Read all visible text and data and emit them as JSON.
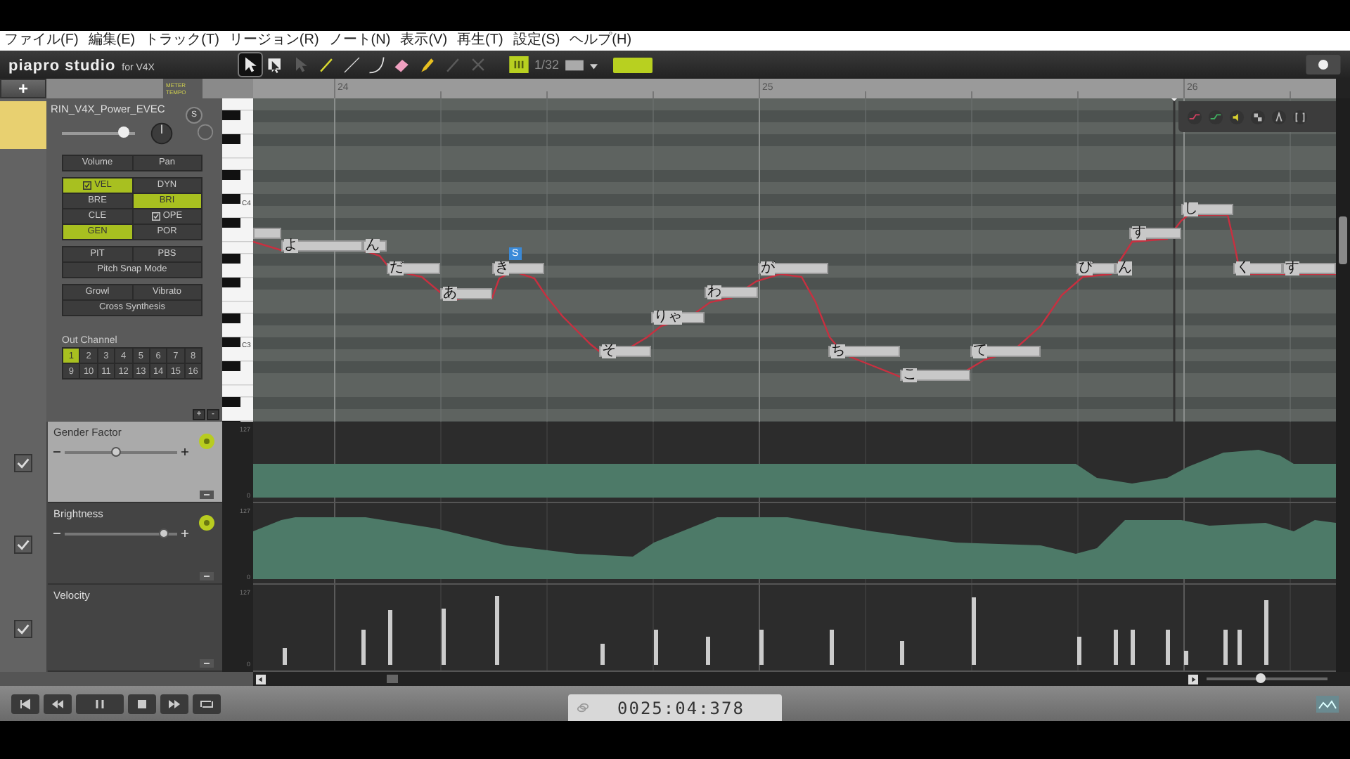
{
  "menu": [
    "ファイル(F)",
    "編集(E)",
    "トラック(T)",
    "リージョン(R)",
    "ノート(N)",
    "表示(V)",
    "再生(T)",
    "設定(S)",
    "ヘルプ(H)"
  ],
  "toolbar": {
    "logo": "piapro studio",
    "logo_sub": "for V4X",
    "quantize": "1/32",
    "tools": [
      {
        "kind": "pointer",
        "selected": true,
        "disabled": false
      },
      {
        "kind": "select",
        "selected": false,
        "disabled": false
      },
      {
        "kind": "pointer",
        "selected": false,
        "disabled": true
      },
      {
        "kind": "pencil",
        "selected": false,
        "disabled": false
      },
      {
        "kind": "line",
        "selected": false,
        "disabled": false
      },
      {
        "kind": "curve",
        "selected": false,
        "disabled": false
      },
      {
        "kind": "eraser",
        "selected": false,
        "disabled": false
      },
      {
        "kind": "brush",
        "selected": false,
        "disabled": false
      },
      {
        "kind": "pencil",
        "selected": false,
        "disabled": true
      },
      {
        "kind": "cross",
        "selected": false,
        "disabled": true
      }
    ]
  },
  "track": {
    "add": "+",
    "meter_tempo": [
      "METER",
      "TEMPO"
    ],
    "name": "RIN_V4X_Power_EVEC",
    "solo": "S",
    "volume": {
      "level": 0.85
    },
    "mix_buttons": [
      "Volume",
      "Pan"
    ],
    "params": [
      {
        "label": "VEL",
        "checked": true,
        "selected": true
      },
      {
        "label": "DYN",
        "checked": false,
        "selected": false
      },
      {
        "label": "BRE",
        "checked": false,
        "selected": false
      },
      {
        "label": "BRI",
        "checked": false,
        "selected": true
      },
      {
        "label": "CLE",
        "checked": false,
        "selected": false
      },
      {
        "label": "OPE",
        "checked": true,
        "selected": false
      },
      {
        "label": "GEN",
        "checked": false,
        "selected": true
      },
      {
        "label": "POR",
        "checked": false,
        "selected": false
      }
    ],
    "pitch_buttons": [
      "PIT",
      "PBS"
    ],
    "pitch_snap": "Pitch Snap Mode",
    "effects": [
      "Growl",
      "Vibrato"
    ],
    "cross": "Cross Synthesis",
    "out_channel": {
      "label": "Out Channel",
      "channels": [
        {
          "label": "1",
          "selected": true
        },
        {
          "label": "2",
          "selected": false
        },
        {
          "label": "3",
          "selected": false
        },
        {
          "label": "4",
          "selected": false
        },
        {
          "label": "5",
          "selected": false
        },
        {
          "label": "6",
          "selected": false
        },
        {
          "label": "7",
          "selected": false
        },
        {
          "label": "8",
          "selected": false
        },
        {
          "label": "9",
          "selected": false
        },
        {
          "label": "10",
          "selected": false
        },
        {
          "label": "11",
          "selected": false
        },
        {
          "label": "12",
          "selected": false
        },
        {
          "label": "13",
          "selected": false
        },
        {
          "label": "14",
          "selected": false
        },
        {
          "label": "15",
          "selected": false
        },
        {
          "label": "16",
          "selected": false
        }
      ]
    },
    "lane_buttons": [
      "+",
      "-"
    ]
  },
  "ruler": [
    "24",
    "25",
    "26"
  ],
  "keys": [
    "C4",
    "C3"
  ],
  "notes": [
    {
      "selected": false
    },
    {
      "lyric": "よ",
      "selected": false
    },
    {
      "lyric": "ん",
      "selected": false
    },
    {
      "lyric": "だ",
      "selected": false
    },
    {
      "lyric": "あ",
      "selected": false
    },
    {
      "lyric": "き",
      "selected": false,
      "badge": "S"
    },
    {
      "lyric": "そ",
      "selected": false
    },
    {
      "lyric": "りゃ",
      "selected": false
    },
    {
      "lyric": "わ",
      "selected": false
    },
    {
      "lyric": "が",
      "selected": false
    },
    {
      "lyric": "ち",
      "selected": false
    },
    {
      "lyric": "こ",
      "selected": false
    },
    {
      "lyric": "て",
      "selected": false
    },
    {
      "lyric": "ぴ",
      "selected": false
    },
    {
      "lyric": "ん",
      "selected": false
    },
    {
      "lyric": "す",
      "selected": false
    },
    {
      "lyric": "し",
      "selected": false
    },
    {
      "lyric": "く",
      "selected": false
    },
    {
      "lyric": "す",
      "selected": false
    }
  ],
  "lanes": [
    {
      "kind": "gender",
      "label": "Gender Factor",
      "selected": true,
      "checked": true,
      "slider": {
        "level": 0.45
      },
      "axis": [
        "127",
        "0"
      ]
    },
    {
      "kind": "brightness",
      "label": "Brightness",
      "selected": false,
      "checked": true,
      "slider": {
        "level": 0.88
      },
      "axis": [
        "127",
        "0"
      ]
    },
    {
      "kind": "velocity",
      "label": "Velocity",
      "selected": false,
      "checked": true,
      "axis": [
        "127",
        "0"
      ]
    }
  ],
  "zoom": {
    "level": 0.45
  },
  "transport": {
    "time": "0025:04:378"
  }
}
